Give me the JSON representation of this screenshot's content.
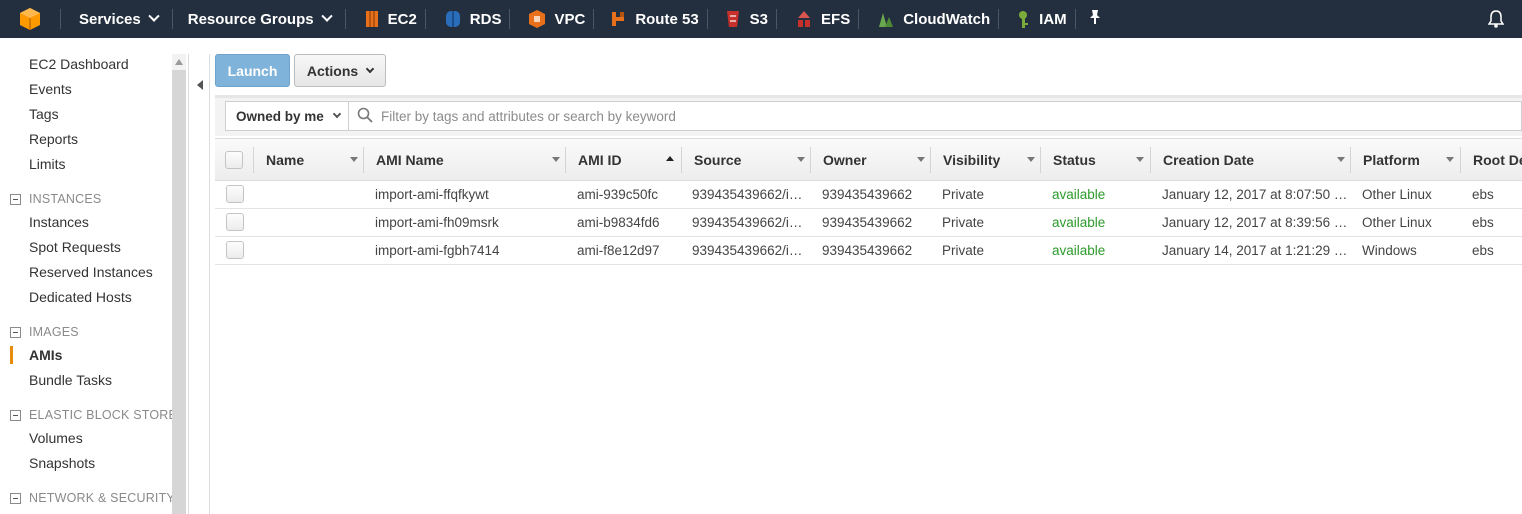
{
  "nav": {
    "services": "Services",
    "resource_groups": "Resource Groups",
    "shortcuts": [
      "EC2",
      "RDS",
      "VPC",
      "Route 53",
      "S3",
      "EFS",
      "CloudWatch",
      "IAM"
    ]
  },
  "sidebar": {
    "top_links": [
      "EC2 Dashboard",
      "Events",
      "Tags",
      "Reports",
      "Limits"
    ],
    "sections": [
      {
        "title": "INSTANCES",
        "items": [
          "Instances",
          "Spot Requests",
          "Reserved Instances",
          "Dedicated Hosts"
        ]
      },
      {
        "title": "IMAGES",
        "items": [
          "AMIs",
          "Bundle Tasks"
        ]
      },
      {
        "title": "ELASTIC BLOCK STORE",
        "items": [
          "Volumes",
          "Snapshots"
        ]
      },
      {
        "title": "NETWORK & SECURITY",
        "items": []
      }
    ],
    "active_item": "AMIs"
  },
  "toolbar": {
    "launch": "Launch",
    "actions": "Actions"
  },
  "filter": {
    "owner_select": "Owned by me",
    "search_placeholder": "Filter by tags and attributes or search by keyword"
  },
  "table": {
    "columns": [
      "Name",
      "AMI Name",
      "AMI ID",
      "Source",
      "Owner",
      "Visibility",
      "Status",
      "Creation Date",
      "Platform",
      "Root De"
    ],
    "sorted_column": "AMI ID",
    "rows": [
      {
        "name": "",
        "ami_name": "import-ami-ffqfkywt",
        "ami_id": "ami-939c50fc",
        "source": "939435439662/i…",
        "owner": "939435439662",
        "visibility": "Private",
        "status": "available",
        "creation_date": "January 12, 2017 at 8:07:50 …",
        "platform": "Other Linux",
        "root": "ebs"
      },
      {
        "name": "",
        "ami_name": "import-ami-fh09msrk",
        "ami_id": "ami-b9834fd6",
        "source": "939435439662/i…",
        "owner": "939435439662",
        "visibility": "Private",
        "status": "available",
        "creation_date": "January 12, 2017 at 8:39:56 …",
        "platform": "Other Linux",
        "root": "ebs"
      },
      {
        "name": "",
        "ami_name": "import-ami-fgbh7414",
        "ami_id": "ami-f8e12d97",
        "source": "939435439662/i…",
        "owner": "939435439662",
        "visibility": "Private",
        "status": "available",
        "creation_date": "January 14, 2017 at 1:21:29 …",
        "platform": "Windows",
        "root": "ebs"
      }
    ]
  },
  "colors": {
    "nav_bg": "#232f3e",
    "status_available": "#2c9a2c",
    "active_accent": "#e88b0a",
    "launch_btn": "#7fb3d9"
  }
}
